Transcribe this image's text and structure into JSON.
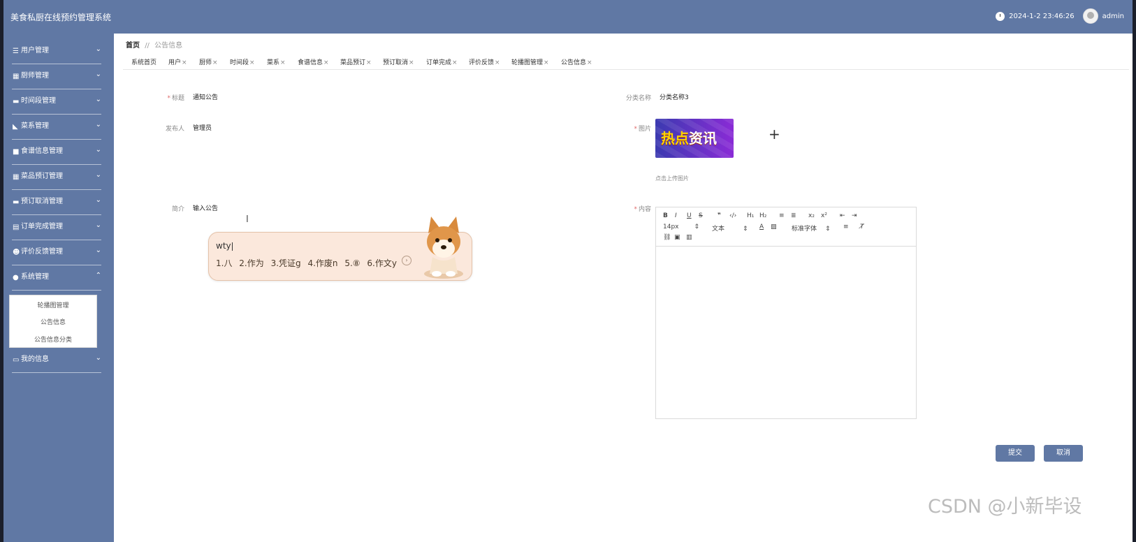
{
  "app": {
    "title": "美食私厨在线预约管理系统",
    "datetime": "2024-1-2 23:46:26",
    "user": "admin"
  },
  "sidebar": {
    "items": [
      {
        "label": "用户管理",
        "icon": "sliders-icon"
      },
      {
        "label": "厨师管理",
        "icon": "grid-icon"
      },
      {
        "label": "时间段管理",
        "icon": "monitor-icon"
      },
      {
        "label": "菜系管理",
        "icon": "thumbs-up-icon"
      },
      {
        "label": "食谱信息管理",
        "icon": "square-icon"
      },
      {
        "label": "菜品预订管理",
        "icon": "grid-icon"
      },
      {
        "label": "预订取消管理",
        "icon": "monitor-icon"
      },
      {
        "label": "订单完成管理",
        "icon": "document-icon"
      },
      {
        "label": "评价反馈管理",
        "icon": "user-icon"
      },
      {
        "label": "系统管理",
        "icon": "pin-icon"
      },
      {
        "label": "我的信息",
        "icon": "card-icon"
      }
    ],
    "system_submenu": [
      "轮播图管理",
      "公告信息",
      "公告信息分类"
    ]
  },
  "breadcrumb": {
    "home": "首页",
    "separator": "//",
    "current": "公告信息"
  },
  "tabs": [
    {
      "label": "系统首页",
      "closable": false
    },
    {
      "label": "用户",
      "closable": true
    },
    {
      "label": "厨师",
      "closable": true
    },
    {
      "label": "时间段",
      "closable": true
    },
    {
      "label": "菜系",
      "closable": true
    },
    {
      "label": "食谱信息",
      "closable": true
    },
    {
      "label": "菜品预订",
      "closable": true
    },
    {
      "label": "预订取消",
      "closable": true
    },
    {
      "label": "订单完成",
      "closable": true
    },
    {
      "label": "评价反馈",
      "closable": true
    },
    {
      "label": "轮播图管理",
      "closable": true
    },
    {
      "label": "公告信息",
      "closable": true
    }
  ],
  "tab_close_glyph": "×",
  "form": {
    "title": {
      "label": "标题",
      "value": "通知公告",
      "required": true
    },
    "category": {
      "label": "分类名称",
      "value": "分类名称3"
    },
    "publisher": {
      "label": "发布人",
      "value": "管理员"
    },
    "image": {
      "label": "图片",
      "required": true,
      "thumb_text_a": "热点",
      "thumb_text_b": "资讯",
      "upload_hint": "点击上传图片",
      "plus": "+"
    },
    "summary": {
      "label": "简介",
      "value": "输入公告"
    },
    "content": {
      "label": "内容",
      "required": true
    },
    "required_mark": "*"
  },
  "editor": {
    "font_size": "14px",
    "block_format": "文本",
    "font_family": "标准字体",
    "buttons_row1": [
      "B",
      "I",
      "U",
      "S",
      "❞",
      "‹/›",
      "H₁",
      "H₂",
      "≡",
      "≣",
      "x₂",
      "x²",
      "⇤",
      "⇥"
    ],
    "color_a": "A",
    "color_bg": "▨",
    "align": "≡",
    "clear": "T̸"
  },
  "ime": {
    "composition": "wty",
    "candidates": [
      "1.八",
      "2.作为",
      "3.凭证g",
      "4.作废n",
      "5.⑧",
      "6.作文y"
    ],
    "more": "›"
  },
  "buttons": {
    "submit": "提交",
    "cancel": "取消"
  },
  "watermark": "CSDN @小新毕设",
  "colors": {
    "primary": "#6078a4",
    "required": "#e06a6a",
    "ime_bg": "#fbe8dc"
  }
}
